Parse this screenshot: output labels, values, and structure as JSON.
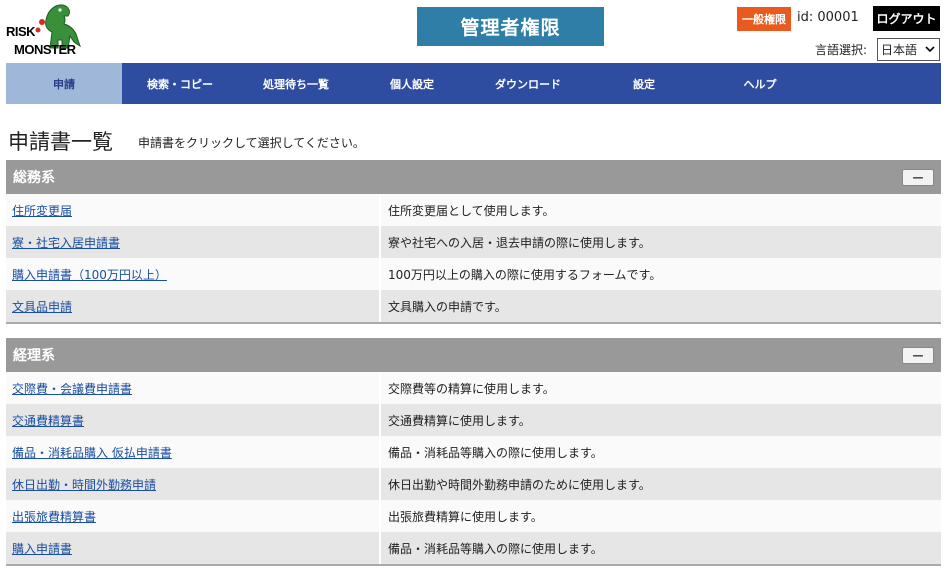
{
  "header": {
    "logo_line1": "RISK",
    "logo_line2": "MONSTER",
    "admin_badge": "管理者権限",
    "permission_badge": "一般権限",
    "user_id": "id: 00001",
    "logout_label": "ログアウト",
    "language_label": "言語選択:",
    "language_value": "日本語"
  },
  "nav": {
    "items": [
      {
        "label": "申請"
      },
      {
        "label": "検索・コピー"
      },
      {
        "label": "処理待ち一覧"
      },
      {
        "label": "個人設定"
      },
      {
        "label": "ダウンロード"
      },
      {
        "label": "設定"
      },
      {
        "label": "ヘルプ"
      }
    ]
  },
  "main": {
    "title": "申請書一覧",
    "hint": "申請書をクリックして選択してください。",
    "sections": [
      {
        "title": "総務系",
        "toggle": "—",
        "rows": [
          {
            "name": "住所変更届",
            "desc": "住所変更届として使用します。"
          },
          {
            "name": "寮・社宅入居申請書",
            "desc": "寮や社宅への入居・退去申請の際に使用します。"
          },
          {
            "name": "購入申請書（100万円以上）",
            "desc": "100万円以上の購入の際に使用するフォームです。"
          },
          {
            "name": "文具品申請",
            "desc": "文具購入の申請です。"
          }
        ]
      },
      {
        "title": "経理系",
        "toggle": "—",
        "rows": [
          {
            "name": "交際費・会議費申請書",
            "desc": "交際費等の精算に使用します。"
          },
          {
            "name": "交通費精算書",
            "desc": "交通費精算に使用します。"
          },
          {
            "name": "備品・消耗品購入 仮払申請書",
            "desc": "備品・消耗品等購入の際に使用します。"
          },
          {
            "name": "休日出勤・時間外勤務申請",
            "desc": "休日出勤や時間外勤務申請のために使用します。"
          },
          {
            "name": "出張旅費精算書",
            "desc": "出張旅費精算に使用します。"
          },
          {
            "name": "購入申請書",
            "desc": "備品・消耗品等購入の際に使用します。"
          }
        ]
      }
    ]
  }
}
